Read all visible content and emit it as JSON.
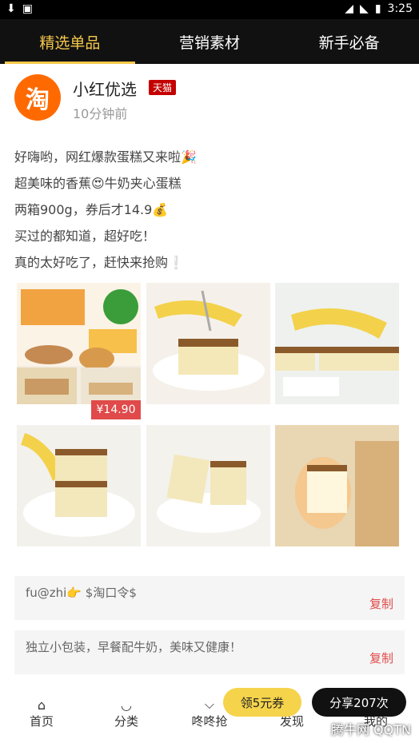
{
  "status": {
    "time": "3:25",
    "icons": [
      "download-icon",
      "image-icon",
      "wifi-icon",
      "signal-icon",
      "battery-icon"
    ]
  },
  "tabs": [
    {
      "label": "精选单品",
      "active": true
    },
    {
      "label": "营销素材",
      "active": false
    },
    {
      "label": "新手必备",
      "active": false
    }
  ],
  "profile": {
    "avatar_char": "淘",
    "name": "小红优选",
    "badge": "天猫",
    "time": "10分钟前"
  },
  "description": [
    "好嗨哟，网红爆款蛋糕又来啦🎉",
    "超美味的香蕉😍牛奶夹心蛋糕",
    "两箱900g，券后才14.9💰",
    "买过的都知道，超好吃！",
    "真的太好吃了，赶快来抢购❕"
  ],
  "price_tag": "¥14.90",
  "cards": [
    {
      "text": "fu@zhi👉 $淘口令$",
      "copy": "复制"
    },
    {
      "text": "独立小包装，早餐配牛奶，美味又健康！",
      "copy": "复制"
    }
  ],
  "actions": {
    "coupon": "领5元券",
    "share": "分享207次"
  },
  "nav": [
    {
      "label": "首页"
    },
    {
      "label": "分类"
    },
    {
      "label": "咚咚抢"
    },
    {
      "label": "发现"
    },
    {
      "label": "我的"
    }
  ],
  "watermark": "腾牛网 QQTN"
}
